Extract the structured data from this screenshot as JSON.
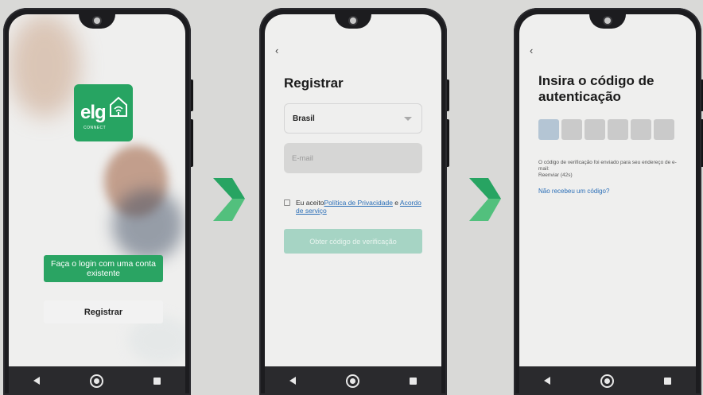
{
  "screen1": {
    "logo_text": "elg",
    "logo_sub": "CONNECT",
    "login_label": "Faça o login com uma conta existente",
    "register_label": "Registrar"
  },
  "screen2": {
    "back": "‹",
    "title": "Registrar",
    "country": "Brasil",
    "email_placeholder": "E-mail",
    "agree_prefix": "Eu aceito",
    "privacy_link": "Política de Privacidade",
    "agree_and": " e ",
    "service_link": "Acordo de serviço",
    "code_button": "Obter código de verificação"
  },
  "screen3": {
    "back": "‹",
    "title": "Insira o código de autenticação",
    "info_line1": "O código de verificação foi enviado para seu endereço de e-mail:",
    "resend": "Reenviar (42s)",
    "no_code": "Não recebeu um código?"
  },
  "colors": {
    "accent": "#27a462",
    "link": "#2a6eb7",
    "background": "#d9d9d7"
  }
}
